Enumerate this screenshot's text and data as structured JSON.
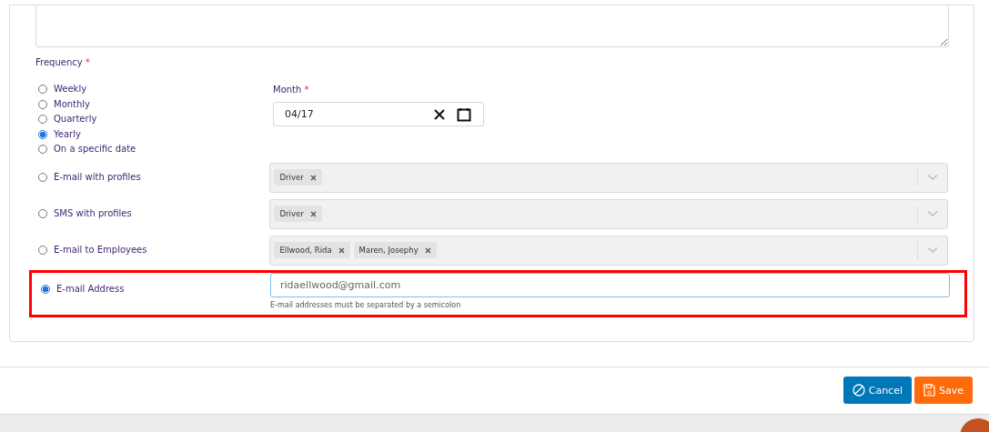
{
  "frequency": {
    "label": "Frequency",
    "required_mark": "*",
    "options": [
      {
        "label": "Weekly",
        "selected": false
      },
      {
        "label": "Monthly",
        "selected": false
      },
      {
        "label": "Quarterly",
        "selected": false
      },
      {
        "label": "Yearly",
        "selected": true
      },
      {
        "label": "On a specific date",
        "selected": false
      }
    ]
  },
  "month": {
    "label": "Month",
    "required_mark": "*",
    "value": "04/17"
  },
  "recipients": [
    {
      "kind": "select",
      "label": "E-mail with profiles",
      "selected": false,
      "highlighted": false,
      "tags": [
        "Driver"
      ]
    },
    {
      "kind": "select",
      "label": "SMS with profiles",
      "selected": false,
      "highlighted": false,
      "tags": [
        "Driver"
      ]
    },
    {
      "kind": "select",
      "label": "E-mail to Employees",
      "selected": false,
      "highlighted": false,
      "tags": [
        "Ellwood, Rida",
        "Maren, Josephy"
      ]
    },
    {
      "kind": "text",
      "label": "E-mail Address",
      "selected": true,
      "highlighted": true,
      "placeholder": "ridaellwood@gmail.com",
      "hint": "E-mail addresses must be separated by a semicolon"
    }
  ],
  "buttons": [
    {
      "kind": "cancel",
      "label": "Cancel"
    },
    {
      "kind": "save",
      "label": "Save"
    }
  ]
}
